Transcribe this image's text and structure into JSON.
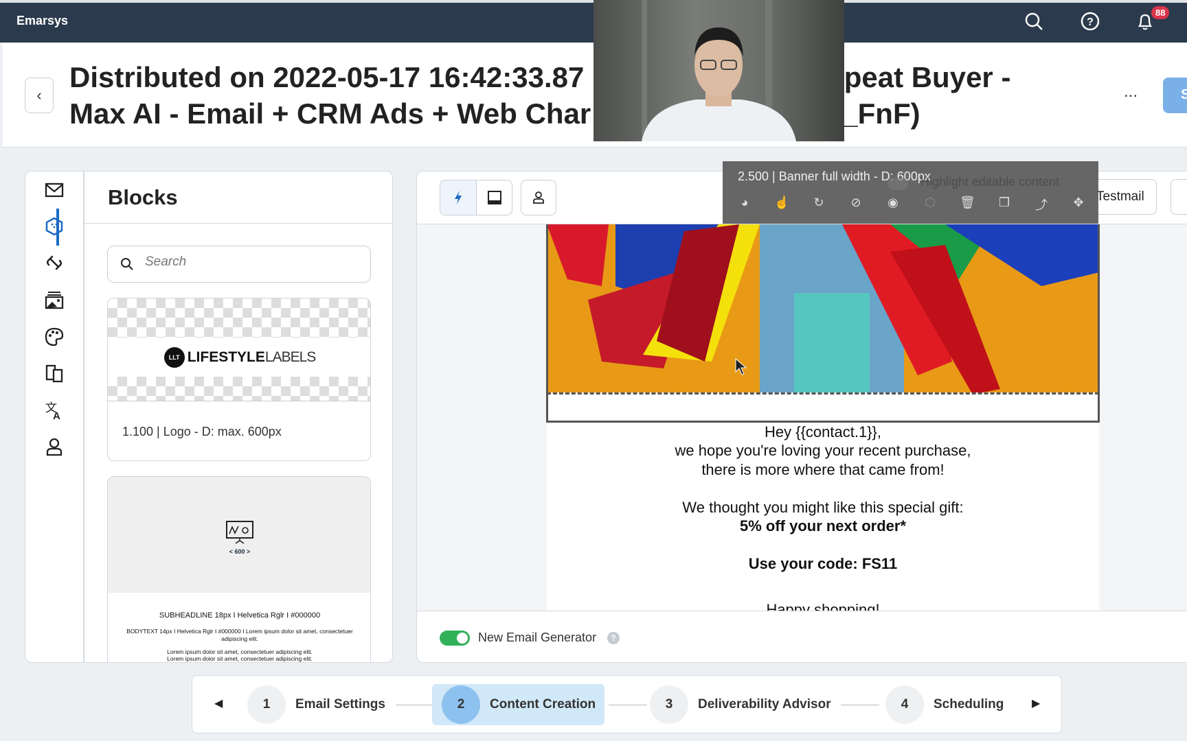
{
  "app": {
    "brand": "Emarsys",
    "notification_count": "88"
  },
  "header": {
    "title": "Distributed on 2022-05-17 16:42:33.87 … epeat Buyer - Max AI - Email + CRM Ads + Web Char… _FnF)",
    "title_line1": "Distributed on 2022-05-17 16:42:33.87",
    "title_line1b": "epeat Buyer -",
    "title_line2": "Max AI - Email + CRM Ads + Web Char",
    "title_line2b": "_FnF)",
    "more_label": "...",
    "primary_label": "S"
  },
  "rail": {
    "items": [
      "mail-icon",
      "blocks-icon",
      "link-icon",
      "image-gallery-icon",
      "palette-icon",
      "devices-icon",
      "translate-icon",
      "person-icon"
    ],
    "active": "blocks-icon",
    "accent": "#1b6bc4"
  },
  "blocks": {
    "title": "Blocks",
    "search_placeholder": "Search",
    "cards": [
      {
        "logo_text_bold": "LIFESTYLE",
        "logo_text_light": "LABELS",
        "logo_badge": "LLT",
        "label": "1.100 | Logo - D: max. 600px"
      },
      {
        "width_label": "< 600 >",
        "subheadline": "SUBHEADLINE 18px I Helvetica Rglr I #000000",
        "bodytext": "BODYTEXT 14px I Helvetica Rglr I #000000 I Lorem ipsum dolor sit amet, consectetuer adipiscing elit.",
        "lorem1": "Lorem ipsum dolor sit amet, consectetuer adipiscing elit.",
        "lorem2": "Lorem ipsum dolor sit amet, consectetuer adipiscing elit."
      }
    ]
  },
  "editor": {
    "block_toolbar": {
      "title": "2.500 | Banner full width - D: 600px",
      "icons": [
        "palette-icon",
        "touch-icon",
        "reset-icon",
        "no-format-icon",
        "radio-icon",
        "cube-icon",
        "delete-icon",
        "copy-icon",
        "move-up-icon",
        "drag-icon"
      ]
    },
    "highlight_label": "Highlight editable content",
    "testmail_label": "Testmail",
    "email": {
      "greeting": "Hey {{contact.1}},",
      "line2": "we hope you're loving your recent purchase,",
      "line3": "there is more where that came from!",
      "line4": "We thought you might like this special gift:",
      "offer": "5% off your next order*",
      "code": "Use your code: FS11",
      "signoff": "Happy shopping!"
    },
    "footer": {
      "toggle_label": "New Email Generator",
      "toggle_on": true,
      "toggle_color": "#31b05a"
    }
  },
  "stepper": {
    "steps": [
      {
        "num": "1",
        "label": "Email Settings"
      },
      {
        "num": "2",
        "label": "Content Creation",
        "active": true
      },
      {
        "num": "3",
        "label": "Deliverability Advisor"
      },
      {
        "num": "4",
        "label": "Scheduling"
      }
    ]
  }
}
